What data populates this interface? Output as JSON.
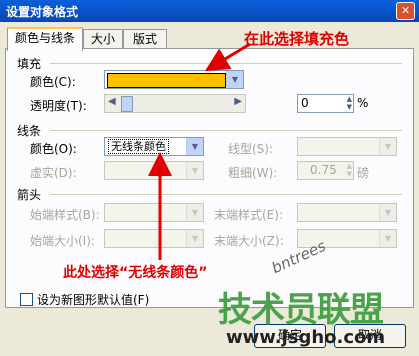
{
  "window": {
    "title": "设置对象格式",
    "close_icon": "✕"
  },
  "tabs": [
    "颜色与线条",
    "大小",
    "版式"
  ],
  "fill": {
    "section": "填充",
    "color_label": "颜色(C):",
    "color_value": "#ffc000",
    "transparency_label": "透明度(T):",
    "transparency_value": "0",
    "percent": "%"
  },
  "line": {
    "section": "线条",
    "color_label": "颜色(O):",
    "color_value": "无线条颜色",
    "style_label": "线型(S):",
    "dash_label": "虚实(D):",
    "weight_label": "粗细(W):",
    "weight_value": "0.75",
    "weight_unit": "磅"
  },
  "arrows": {
    "section": "箭头",
    "begin_style_label": "始端样式(B):",
    "end_style_label": "末端样式(E):",
    "begin_size_label": "始端大小(I):",
    "end_size_label": "末端大小(Z):"
  },
  "default_checkbox_label": "设为新图形默认值(F)",
  "annotations": {
    "fill_note": "在此选择填充色",
    "line_note": "此处选择“无线条颜色”",
    "color_red": "#e00000"
  },
  "buttons": {
    "ok": "确定",
    "cancel": "取消"
  },
  "watermark": {
    "logo": "技术员联盟",
    "url": "www.jsgho.com",
    "stamp": "bntrees"
  }
}
